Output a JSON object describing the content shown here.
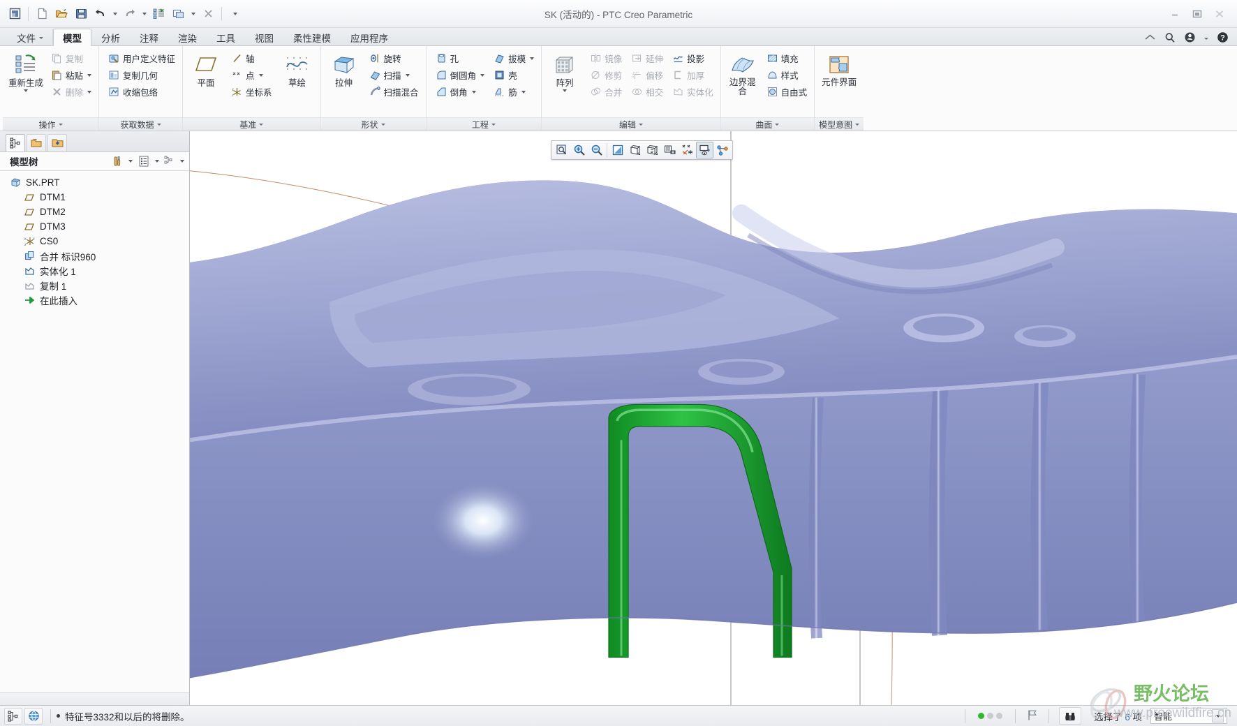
{
  "window": {
    "title": "SK (活动的) - PTC Creo Parametric",
    "minimize": "minimize-icon",
    "restore": "restore-icon",
    "close": "close-icon"
  },
  "quick_access": [
    {
      "name": "creo-logo-icon",
      "label": ""
    },
    {
      "name": "new-file-icon",
      "label": ""
    },
    {
      "name": "open-file-icon",
      "label": ""
    },
    {
      "name": "save-icon",
      "label": ""
    },
    {
      "name": "undo-icon",
      "label": ""
    },
    {
      "name": "redo-icon",
      "label": ""
    },
    {
      "name": "regenerate-icon",
      "label": ""
    },
    {
      "name": "window-icon",
      "label": ""
    },
    {
      "name": "close-window-icon",
      "label": ""
    },
    {
      "name": "customize-qat-icon",
      "label": ""
    }
  ],
  "tabs": [
    {
      "label": "文件",
      "active": false,
      "dropdown": true
    },
    {
      "label": "模型",
      "active": true
    },
    {
      "label": "分析",
      "active": false
    },
    {
      "label": "注释",
      "active": false
    },
    {
      "label": "渲染",
      "active": false
    },
    {
      "label": "工具",
      "active": false
    },
    {
      "label": "视图",
      "active": false
    },
    {
      "label": "柔性建模",
      "active": false
    },
    {
      "label": "应用程序",
      "active": false
    }
  ],
  "tabbar_right": [
    {
      "name": "collapse-ribbon-icon"
    },
    {
      "name": "search-icon"
    },
    {
      "name": "account-icon"
    },
    {
      "name": "help-icon"
    }
  ],
  "ribbon": {
    "groups": [
      {
        "title": "操作",
        "big": [
          {
            "label": "重新生成",
            "icon": "regenerate-icon",
            "dropdown": true
          }
        ],
        "columns": [
          [
            {
              "label": "复制",
              "icon": "copy-icon",
              "disabled": true
            },
            {
              "label": "粘贴",
              "icon": "paste-icon",
              "dropdown": true
            },
            {
              "label": "删除",
              "icon": "delete-icon",
              "disabled": true,
              "dropdown": true
            }
          ]
        ]
      },
      {
        "title": "获取数据",
        "big": [],
        "columns": [
          [
            {
              "label": "用户定义特征",
              "icon": "udf-icon"
            },
            {
              "label": "复制几何",
              "icon": "copy-geometry-icon"
            },
            {
              "label": "收缩包络",
              "icon": "shrinkwrap-icon"
            }
          ]
        ]
      },
      {
        "title": "基准",
        "big": [
          {
            "label": "平面",
            "icon": "datum-plane-icon"
          },
          {
            "label": "草绘",
            "icon": "sketch-icon"
          }
        ],
        "columns": [
          [
            {
              "label": "轴",
              "icon": "axis-icon"
            },
            {
              "label": "点",
              "icon": "point-icon",
              "dropdown": true
            },
            {
              "label": "坐标系",
              "icon": "csys-icon"
            }
          ]
        ]
      },
      {
        "title": "形状",
        "big": [
          {
            "label": "拉伸",
            "icon": "extrude-icon"
          }
        ],
        "columns": [
          [
            {
              "label": "旋转",
              "icon": "revolve-icon"
            },
            {
              "label": "扫描",
              "icon": "sweep-icon",
              "dropdown": true
            },
            {
              "label": "扫描混合",
              "icon": "swept-blend-icon"
            }
          ]
        ]
      },
      {
        "title": "工程",
        "big": [],
        "columns": [
          [
            {
              "label": "孔",
              "icon": "hole-icon"
            },
            {
              "label": "倒圆角",
              "icon": "round-icon",
              "dropdown": true
            },
            {
              "label": "倒角",
              "icon": "chamfer-icon",
              "dropdown": true
            }
          ],
          [
            {
              "label": "拔模",
              "icon": "draft-icon",
              "dropdown": true
            },
            {
              "label": "壳",
              "icon": "shell-icon"
            },
            {
              "label": "筋",
              "icon": "rib-icon",
              "dropdown": true
            }
          ]
        ]
      },
      {
        "title": "编辑",
        "big": [
          {
            "label": "阵列",
            "icon": "pattern-icon",
            "dropdown": true
          }
        ],
        "columns": [
          [
            {
              "label": "镜像",
              "icon": "mirror-icon",
              "disabled": true
            },
            {
              "label": "修剪",
              "icon": "trim-icon",
              "disabled": true
            },
            {
              "label": "合并",
              "icon": "merge-icon",
              "disabled": true
            }
          ],
          [
            {
              "label": "延伸",
              "icon": "extend-icon",
              "disabled": true
            },
            {
              "label": "偏移",
              "icon": "offset-icon",
              "disabled": true
            },
            {
              "label": "相交",
              "icon": "intersect-icon",
              "disabled": true
            }
          ],
          [
            {
              "label": "投影",
              "icon": "project-icon"
            },
            {
              "label": "加厚",
              "icon": "thicken-icon",
              "disabled": true
            },
            {
              "label": "实体化",
              "icon": "solidify-icon",
              "disabled": true
            }
          ]
        ]
      },
      {
        "title": "曲面",
        "big": [
          {
            "label": "边界混合",
            "icon": "boundary-blend-icon"
          }
        ],
        "columns": [
          [
            {
              "label": "填充",
              "icon": "fill-icon"
            },
            {
              "label": "样式",
              "icon": "style-icon"
            },
            {
              "label": "自由式",
              "icon": "freestyle-icon"
            }
          ]
        ]
      },
      {
        "title": "模型意图",
        "big": [
          {
            "label": "元件界面",
            "icon": "component-interface-icon"
          }
        ],
        "columns": []
      }
    ]
  },
  "navigator": {
    "tabs": [
      {
        "name": "model-tree-tab",
        "icon": "model-tree-icon",
        "active": true
      },
      {
        "name": "folder-browser-tab",
        "icon": "folder-icon",
        "active": false
      },
      {
        "name": "favorites-tab",
        "icon": "favorites-folder-icon",
        "active": false
      }
    ],
    "title": "模型树",
    "tools": [
      {
        "name": "tree-settings-icon"
      },
      {
        "name": "tree-settings-dropdown"
      },
      {
        "name": "tree-columns-icon"
      },
      {
        "name": "tree-columns-dropdown"
      },
      {
        "name": "tree-filter-icon"
      },
      {
        "name": "tree-filter-dropdown"
      }
    ],
    "tree": [
      {
        "label": "SK.PRT",
        "icon": "part-icon",
        "indent": 0
      },
      {
        "label": "DTM1",
        "icon": "datum-plane-icon",
        "indent": 1
      },
      {
        "label": "DTM2",
        "icon": "datum-plane-icon",
        "indent": 1
      },
      {
        "label": "DTM3",
        "icon": "datum-plane-icon",
        "indent": 1
      },
      {
        "label": "CS0",
        "icon": "csys-icon",
        "indent": 1
      },
      {
        "label": "合并 标识960",
        "icon": "merge-icon",
        "indent": 1
      },
      {
        "label": "实体化 1",
        "icon": "solidify-icon",
        "indent": 1
      },
      {
        "label": "复制 1",
        "icon": "copy-geom-icon",
        "indent": 1
      },
      {
        "label": "在此插入",
        "icon": "insert-here-icon",
        "indent": 1
      }
    ]
  },
  "graphics_toolbar": [
    {
      "name": "refit-icon",
      "pressed": false
    },
    {
      "name": "zoom-in-icon",
      "pressed": false
    },
    {
      "name": "zoom-out-icon",
      "pressed": false
    },
    {
      "name": "repaint-icon",
      "pressed": false
    },
    {
      "name": "display-style-icon",
      "pressed": false,
      "dropdown": true
    },
    {
      "name": "saved-views-icon",
      "pressed": false,
      "dropdown": true
    },
    {
      "name": "view-manager-icon",
      "pressed": false
    },
    {
      "name": "datum-display-icon",
      "pressed": false,
      "dropdown": true
    },
    {
      "name": "annotation-display-icon",
      "pressed": true
    },
    {
      "name": "spin-center-icon",
      "pressed": false
    }
  ],
  "viewport": {
    "model_color": "#9aa2cf",
    "model_color_light": "#c3c8e6",
    "model_color_dark": "#7b83b8",
    "highlight_color": "#1ea832",
    "background": "#ffffff",
    "datum_line_color": "#6b6b6b",
    "curve_color": "#b47a4a"
  },
  "statusbar": {
    "left_buttons": [
      {
        "name": "model-tree-toggle-icon"
      },
      {
        "name": "web-browser-toggle-icon"
      }
    ],
    "message": "特征号3332和以后的将删除。",
    "leds": [
      true,
      false,
      false
    ],
    "flag": "flag-icon",
    "select-tool": "binoculars-icon",
    "selection": "选择了",
    "selection_count": "6",
    "selection_unit": "项",
    "filter_value": "智能"
  },
  "watermark": {
    "brand": "野火论坛",
    "url": "www.proewildfire.cn"
  }
}
